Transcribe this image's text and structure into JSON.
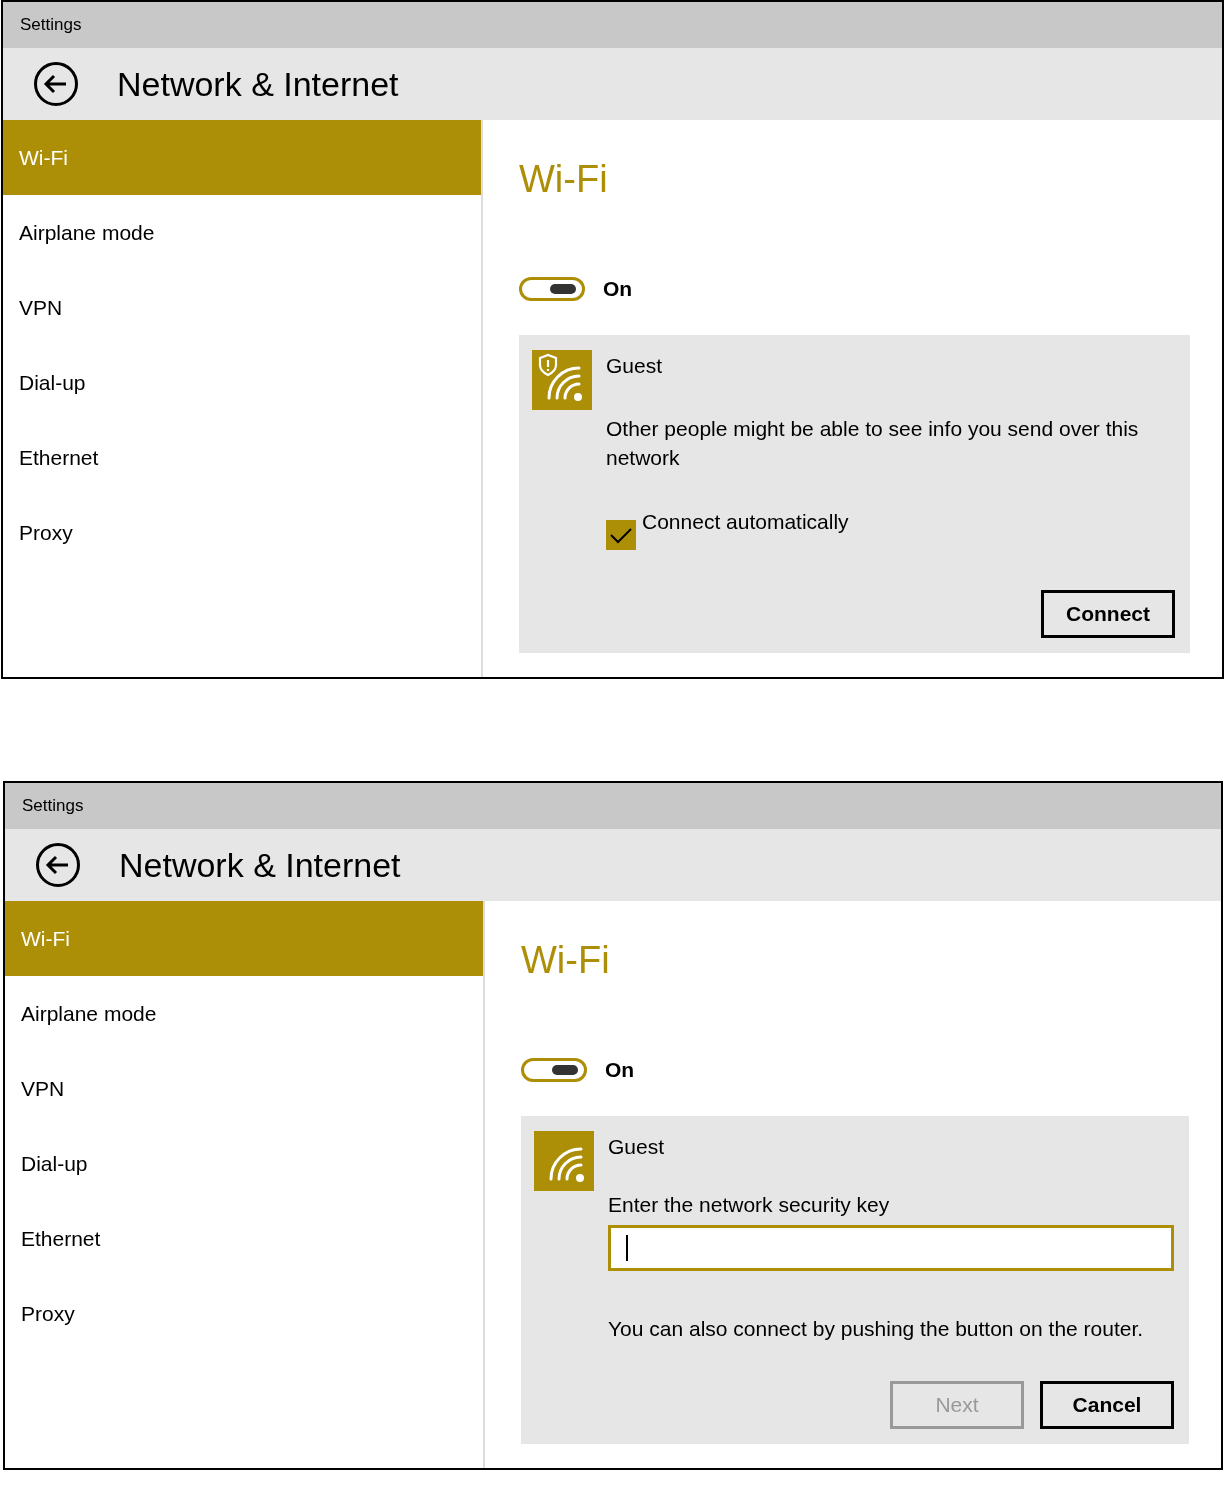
{
  "screens": [
    {
      "window": {
        "title": "Settings"
      },
      "header": {
        "title": "Network & Internet"
      },
      "sidebar": {
        "items": [
          {
            "label": "Wi-Fi",
            "selected": true
          },
          {
            "label": "Airplane mode",
            "selected": false
          },
          {
            "label": "VPN",
            "selected": false
          },
          {
            "label": "Dial-up",
            "selected": false
          },
          {
            "label": "Ethernet",
            "selected": false
          },
          {
            "label": "Proxy",
            "selected": false
          }
        ]
      },
      "section_title": "Wi-Fi",
      "toggle": {
        "on": true,
        "label": "On"
      },
      "network": {
        "kind": "connect",
        "name": "Guest",
        "warning": true,
        "message": "Other people might be able to see info you send over this network",
        "checkbox": {
          "label": "Connect automatically",
          "checked": true
        },
        "buttons": [
          {
            "label": "Connect",
            "disabled": false
          }
        ]
      }
    },
    {
      "window": {
        "title": "Settings"
      },
      "header": {
        "title": "Network & Internet"
      },
      "sidebar": {
        "items": [
          {
            "label": "Wi-Fi",
            "selected": true
          },
          {
            "label": "Airplane mode",
            "selected": false
          },
          {
            "label": "VPN",
            "selected": false
          },
          {
            "label": "Dial-up",
            "selected": false
          },
          {
            "label": "Ethernet",
            "selected": false
          },
          {
            "label": "Proxy",
            "selected": false
          }
        ]
      },
      "section_title": "Wi-Fi",
      "toggle": {
        "on": true,
        "label": "On"
      },
      "network": {
        "kind": "key",
        "name": "Guest",
        "warning": false,
        "prompt": "Enter the network security key",
        "field": {
          "focused": true
        },
        "message": "You can also connect by pushing the button on the router.",
        "buttons": [
          {
            "label": "Next",
            "disabled": true
          },
          {
            "label": "Cancel",
            "disabled": false
          }
        ]
      }
    }
  ]
}
